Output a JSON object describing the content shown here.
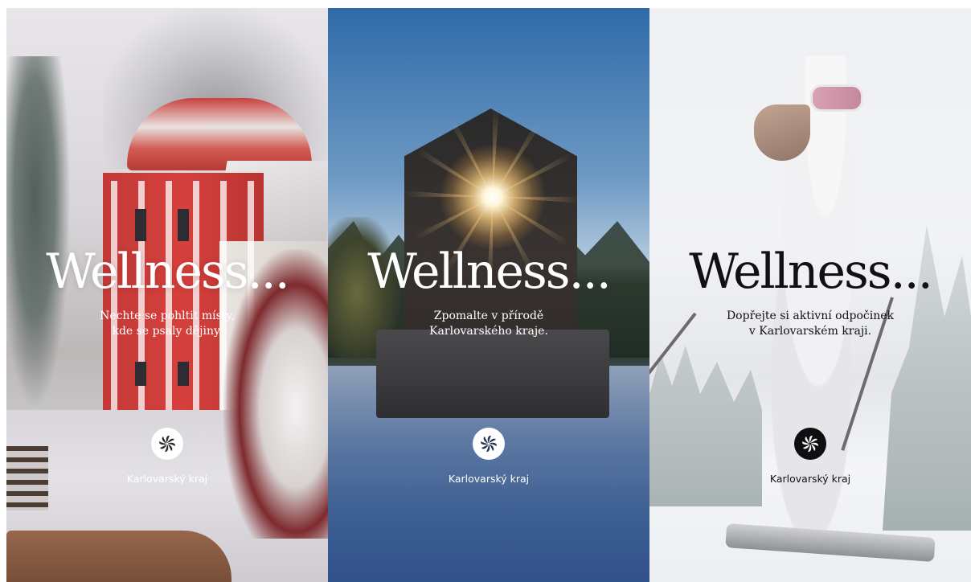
{
  "panels": [
    {
      "title": "Wellness...",
      "subtitle_line1": "Nechte se pohltit místy,",
      "subtitle_line2": "kde se psaly dějiny.",
      "brand": "Karlovarský kraj",
      "theme": "light-text",
      "logo_icon": "pinwheel-flower-icon"
    },
    {
      "title": "Wellness...",
      "subtitle_line1": "Zpomalte v přírodě",
      "subtitle_line2": "Karlovarského kraje.",
      "brand": "Karlovarský kraj",
      "theme": "light-text",
      "logo_icon": "pinwheel-flower-icon"
    },
    {
      "title": "Wellness...",
      "subtitle_line1": "Dopřejte si aktivní odpočinek",
      "subtitle_line2": "v Karlovarském kraji.",
      "brand": "Karlovarský kraj",
      "theme": "dark-text",
      "logo_icon": "pinwheel-flower-icon"
    }
  ],
  "colors": {
    "text_light": "#ffffff",
    "text_dark": "#111114"
  }
}
